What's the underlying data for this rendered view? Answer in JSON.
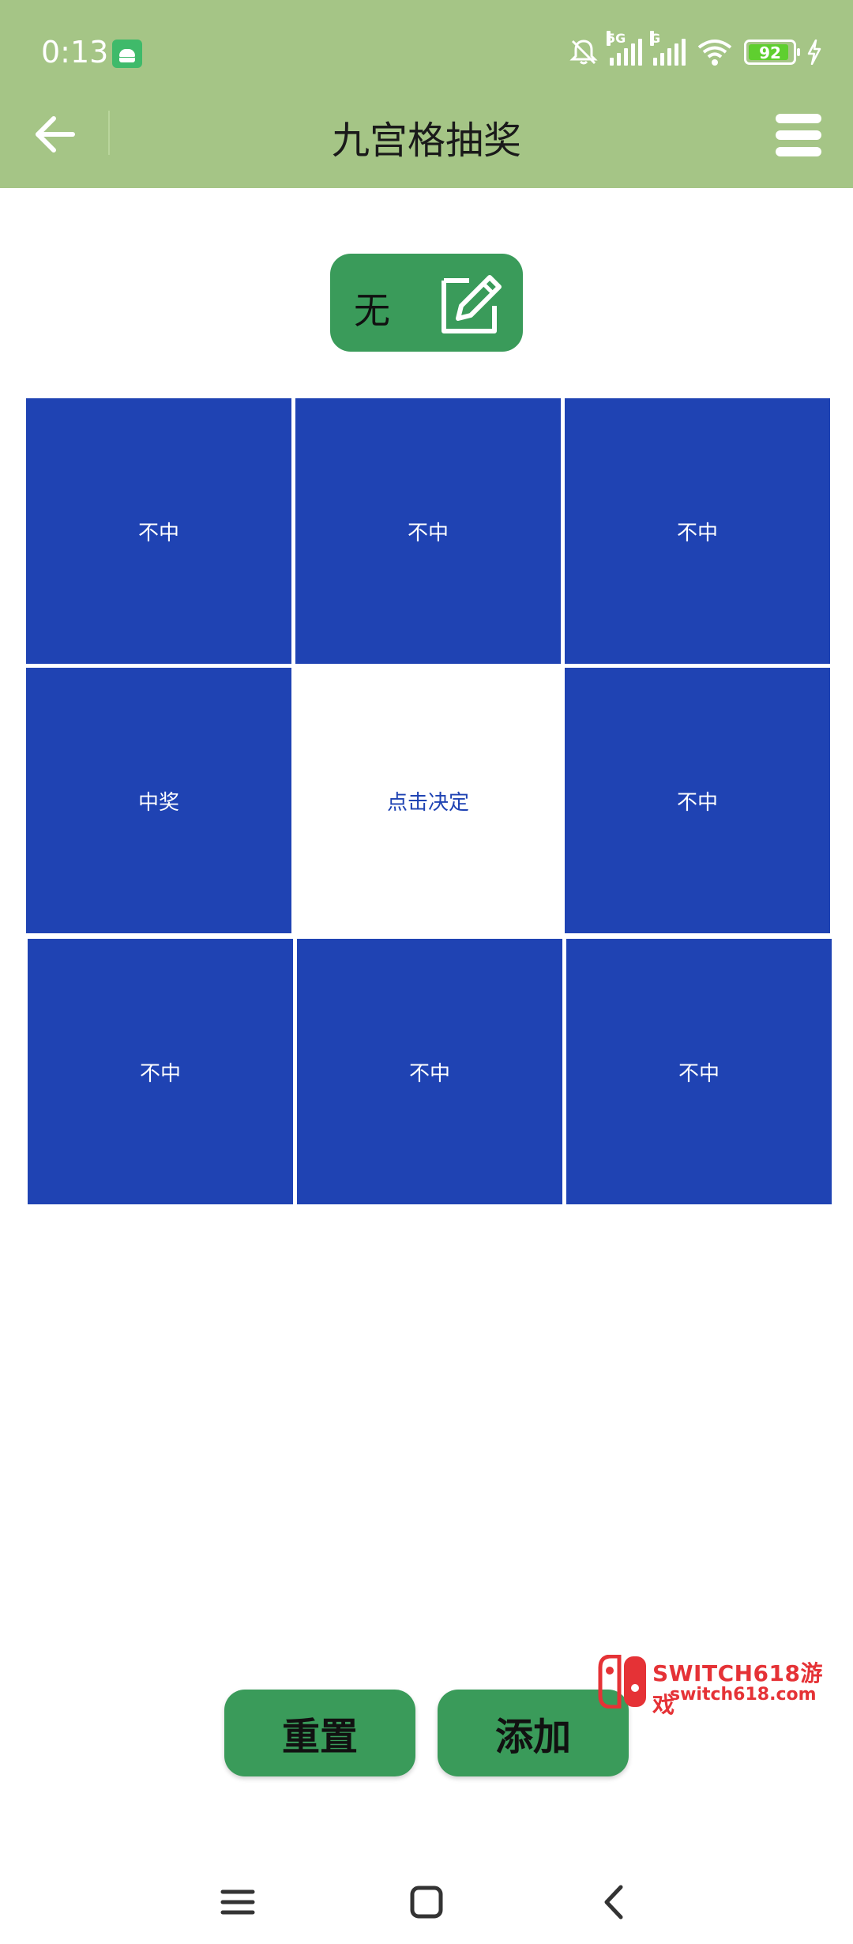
{
  "status_bar": {
    "time": "0:13",
    "network_1": "5G",
    "network_2": "G",
    "battery_level": 92,
    "battery_label": "92",
    "icons": [
      "android-notification-icon",
      "mute-bell-icon",
      "signal-icon",
      "signal-icon",
      "wifi-icon",
      "battery-icon",
      "charging-bolt-icon"
    ]
  },
  "app_bar": {
    "title": "九宫格抽奖",
    "back_icon": "arrow-left-icon",
    "menu_icon": "hamburger-menu-icon"
  },
  "result": {
    "value": "无",
    "edit_icon": "edit-pencil-icon"
  },
  "grid": {
    "cells": [
      "不中",
      "不中",
      "不中",
      "中奖",
      "点击决定",
      "不中",
      "不中",
      "不中",
      "不中"
    ]
  },
  "actions": {
    "reset": "重置",
    "add": "添加"
  },
  "watermark": {
    "title": "SWITCH618游戏",
    "url": "switch618.com"
  },
  "nav_bar": {
    "icons": [
      "recents-menu-icon",
      "home-square-icon",
      "back-chevron-icon"
    ]
  },
  "colors": {
    "app_bar": "#a5c586",
    "cell_blue": "#1f43b3",
    "button_green": "#3a9b5a",
    "watermark_red": "#e53236"
  }
}
